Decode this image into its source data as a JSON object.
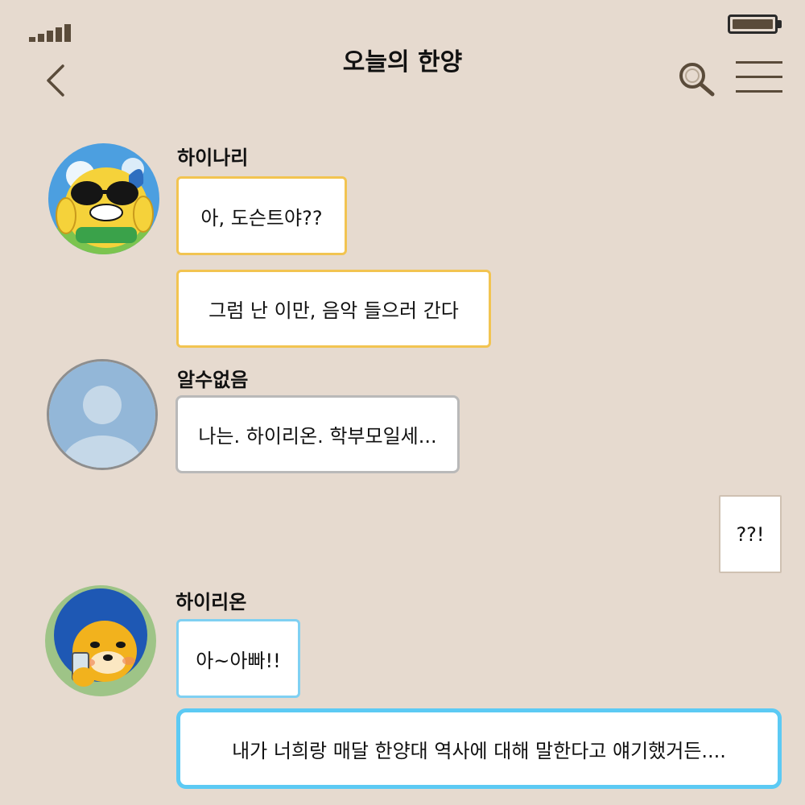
{
  "header": {
    "title": "오늘의 한양"
  },
  "colors": {
    "background": "#e6dacf",
    "icon": "#5a4b3a",
    "bubble_yellow_border": "#f2c451",
    "bubble_gray_border": "#b9b9b9",
    "bubble_blue_border": "#5ccaf4"
  },
  "icons": {
    "signal": "signal-icon",
    "battery": "battery-icon",
    "back": "chevron-left-icon",
    "search": "search-icon",
    "menu": "hamburger-menu-icon"
  },
  "messages": [
    {
      "sender": "하이나리",
      "text": "아, 도슨트야??"
    },
    {
      "sender": "하이나리",
      "text": "그럼 난 이만, 음악 들으러 간다"
    },
    {
      "sender": "알수없음",
      "text": "나는. 하이리온. 학부모일세..."
    },
    {
      "sender": "me",
      "text": "??!"
    },
    {
      "sender": "하이리온",
      "text": "아~아빠!!"
    },
    {
      "sender": "하이리온",
      "text": "내가 너희랑 매달 한양대 역사에 대해 말한다고 얘기했거든...."
    }
  ]
}
